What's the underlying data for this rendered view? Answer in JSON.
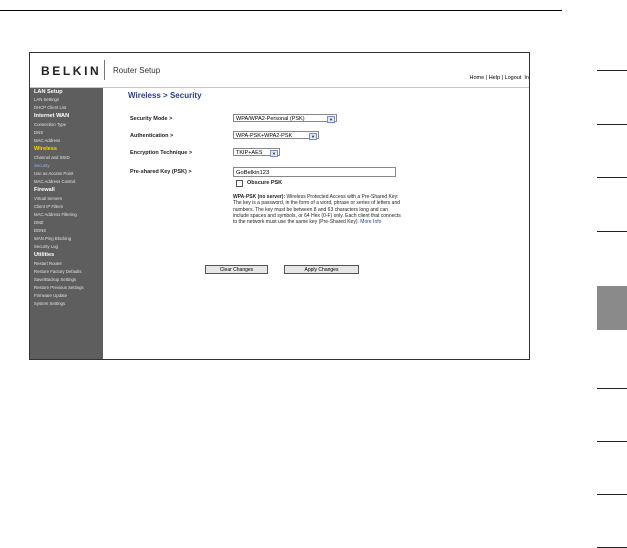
{
  "brand": {
    "logo": "BELKIN",
    "app_title": "Router Setup"
  },
  "top_links": {
    "home": "Home",
    "sep1": " | ",
    "help": "Help",
    "sep2": " | ",
    "logout": "Logout",
    "extra": "In"
  },
  "sidebar": {
    "sections": [
      {
        "title": "LAN Setup",
        "items": [
          "LAN Settings",
          "DHCP Client List"
        ]
      },
      {
        "title": "Internet WAN",
        "items": [
          "Connection Type",
          "DNS",
          "MAC Address"
        ]
      },
      {
        "title": "Wireless",
        "items": [
          "Channel and SSID",
          "Security",
          "Use as Access Point",
          "MAC Address Control"
        ]
      },
      {
        "title": "Firewall",
        "items": [
          "Virtual Servers",
          "Client IP Filters",
          "MAC Address Filtering",
          "DMZ",
          "DDNS",
          "WAN Ping Blocking",
          "Security Log"
        ]
      },
      {
        "title": "Utilities",
        "items": [
          "Restart Router",
          "Restore Factory Defaults",
          "Save/Backup Settings",
          "Restore Previous Settings",
          "Firmware Update",
          "System Settings"
        ]
      }
    ],
    "active_section": "Wireless",
    "active_item": "Security"
  },
  "page": {
    "title": "Wireless > Security"
  },
  "form": {
    "security_mode": {
      "label": "Security Mode >",
      "value": "WPA/WPA2-Personal (PSK)"
    },
    "authentication": {
      "label": "Authentication >",
      "value": "WPA-PSK+WPA2-PSK"
    },
    "encryption": {
      "label": "Encryption Technique >",
      "value": "TKIP+AES"
    },
    "psk": {
      "label": "Pre-shared Key (PSK) >",
      "value": "GoBelkin123"
    },
    "obscure": {
      "label": "Obscure PSK",
      "checked": false
    }
  },
  "help": {
    "lead": "WPA-PSK (no server):",
    "text": " Wireless Protected Access with a Pre-Shared Key: The key is a password, in the form of a word, phrase or series of letters and numbers. The key must be between 8 and 63 characters long and can include spaces and symbols, or 64 Hex (0-F) only. Each client that connects to the network must use the same key (Pre-Shared Key). ",
    "more_info": "More Info"
  },
  "buttons": {
    "clear": "Clear Changes",
    "apply": "Apply Changes"
  },
  "colors": {
    "sidebar_bg": "#5e5e5e",
    "active_section": "#ffd200",
    "active_item": "#8fb4ff",
    "title_blue": "#2a3f8f",
    "side_tab": "#8a8a8a"
  }
}
